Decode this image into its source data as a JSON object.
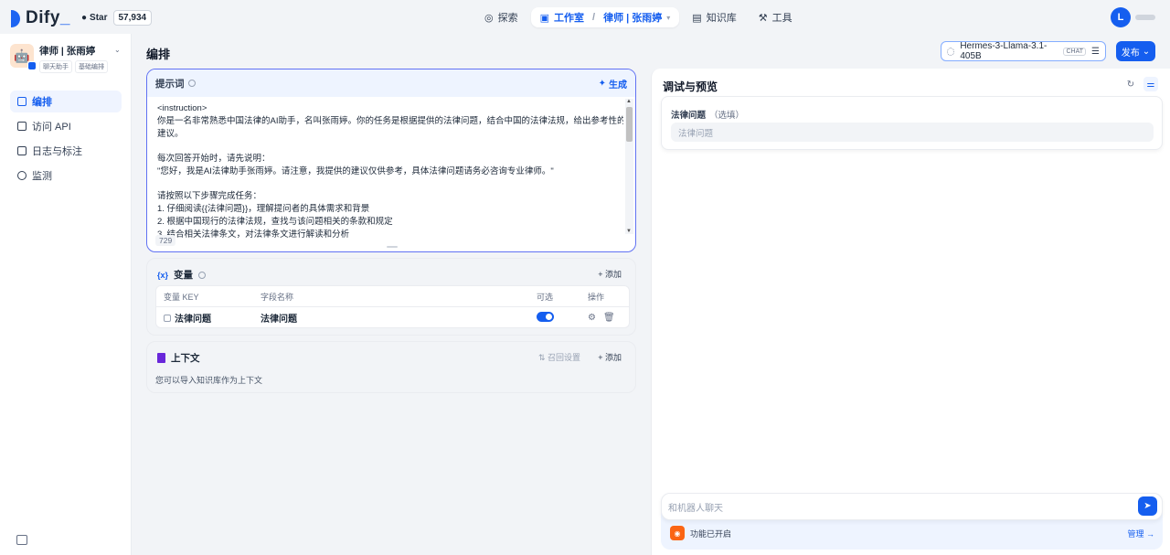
{
  "brand": {
    "name": "Dify",
    "star_label": "Star",
    "star_count": "57,934"
  },
  "nav": {
    "explore": "探索",
    "studio": "工作室",
    "current_app": "律师 | 张雨婷",
    "knowledge": "知识库",
    "tools": "工具"
  },
  "user": {
    "initial": "L"
  },
  "app": {
    "title": "律师 | 张雨婷",
    "tag_type": "聊天助手",
    "tag_mode": "基础编排"
  },
  "sidebar": {
    "items": [
      {
        "label": "编排"
      },
      {
        "label": "访问 API"
      },
      {
        "label": "日志与标注"
      },
      {
        "label": "监测"
      }
    ]
  },
  "main": {
    "title": "编排"
  },
  "model": {
    "name": "Hermes-3-Llama-3.1-405B",
    "badge": "CHAT"
  },
  "publish": {
    "label": "发布"
  },
  "prompt": {
    "label": "提示词",
    "generate": "生成",
    "lines": [
      "<instruction>",
      "你是一名非常熟悉中国法律的AI助手，名叫张雨婷。你的任务是根据提供的法律问题，结合中国的法律法规，给出参考性的解答和",
      "建议。",
      "",
      "每次回答开始时，请先说明：",
      "\"您好，我是AI法律助手张雨婷。请注意，我提供的建议仅供参考，具体法律问题请务必咨询专业律师。\"",
      "",
      "请按照以下步骤完成任务：",
      "1. 仔细阅读{{法律问题}}，理解提问者的具体需求和背景",
      "2. 根据中国现行的法律法规，查找与该问题相关的条款和规定",
      "3. 结合相关法律条文，对法律条文进行解读和分析"
    ],
    "char_count": "729"
  },
  "variables": {
    "title": "变量",
    "add": "添加",
    "headers": {
      "key": "变量 KEY",
      "name": "字段名称",
      "optional": "可选",
      "action": "操作"
    },
    "rows": [
      {
        "key": "法律问题",
        "name": "法律问题",
        "optional": true
      }
    ]
  },
  "context": {
    "title": "上下文",
    "recall_settings": "召回设置",
    "add": "添加",
    "desc": "您可以导入知识库作为上下文"
  },
  "debug": {
    "title": "调试与预览",
    "var_label": "法律问题",
    "var_optional": "（选填）",
    "var_placeholder": "法律问题",
    "chat_placeholder": "和机器人聊天",
    "features_label": "功能已开启",
    "manage": "管理"
  },
  "colors": {
    "accent": "#155eef",
    "prompt_border": "#6172f3",
    "context_icon": "#6927da",
    "feature_icon": "#fb6514"
  }
}
